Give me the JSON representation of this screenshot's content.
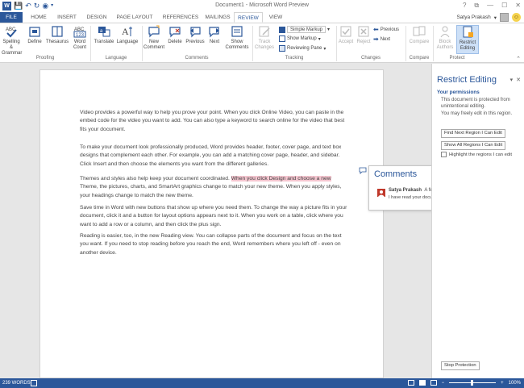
{
  "window": {
    "title": "Document1 - Microsoft Word Preview",
    "controls": [
      "?",
      "⧉",
      "—",
      "☐",
      "✕"
    ]
  },
  "tabs": [
    {
      "label": "FILE"
    },
    {
      "label": "HOME"
    },
    {
      "label": "INSERT"
    },
    {
      "label": "DESIGN"
    },
    {
      "label": "PAGE LAYOUT"
    },
    {
      "label": "REFERENCES"
    },
    {
      "label": "MAILINGS"
    },
    {
      "label": "REVIEW"
    },
    {
      "label": "VIEW"
    }
  ],
  "user": {
    "name": "Satya Prakash"
  },
  "ribbon": {
    "proofing": {
      "label": "Proofing",
      "spelling": "Spelling &\nGrammar",
      "define": "Define",
      "thesaurus": "Thesaurus",
      "word_count": "Word\nCount"
    },
    "language": {
      "label": "Language",
      "translate": "Translate",
      "language": "Language"
    },
    "comments": {
      "label": "Comments",
      "new": "New\nComment",
      "delete": "Delete",
      "previous": "Previous",
      "next": "Next",
      "show": "Show\nComments"
    },
    "tracking": {
      "label": "Tracking",
      "track_changes": "Track\nChanges",
      "markup_mode": "Simple Markup",
      "show_markup": "Show Markup",
      "reviewing_pane": "Reviewing Pane"
    },
    "changes": {
      "label": "Changes",
      "accept": "Accept",
      "reject": "Reject",
      "previous": "Previous",
      "next": "Next"
    },
    "compare": {
      "label": "Compare",
      "compare": "Compare"
    },
    "protect": {
      "label": "Protect",
      "block_authors": "Block\nAuthors",
      "restrict_editing": "Restrict\nEditing"
    }
  },
  "document": {
    "paragraphs": [
      {
        "text": "Video provides a powerful way to help you prove your point. When you click Online Video, you can paste in the embed code for the video you want to add. You can also type a keyword to search online for the video that best fits your document."
      },
      {
        "text": "To make your document look professionally produced, Word provides header, footer, cover page, and text box designs that complement each other. For example, you can add a matching cover page, header, and sidebar. Click Insert and then choose the elements you want from the different galleries."
      },
      {
        "before": "Themes and styles also help keep your document coordinated. ",
        "highlight": "When you click Design and choose a new",
        "after": " Theme, the pictures, charts, and SmartArt graphics change to match your new theme. When you apply styles, your headings change to match the new theme."
      },
      {
        "text": "Save time in Word with new buttons that show up where you need them. To change the way a picture fits in your document, click it and a button for layout options appears next to it. When you work on a table, click where you want to add a row or a column, and then click the plus sign."
      },
      {
        "text": "Reading is easier, too, in the new Reading view. You can collapse parts of the document and focus on the text you want. If you need to stop reading before you reach the end, Word remembers where you left off - even on another device."
      }
    ]
  },
  "comments_pane": {
    "title": "Comments",
    "entries": [
      {
        "author": "Satya Prakash",
        "time": "A few seconds ago",
        "text": "I have read your document. No any mistake found"
      }
    ]
  },
  "restrict_pane": {
    "title": "Restrict Editing",
    "permissions_heading": "Your permissions",
    "protected_text": "This document is protected from unintentional editing.",
    "freely_edit_text": "You may freely edit in this region.",
    "find_next_label": "Find Next Region I Can Edit",
    "show_all_label": "Show All Regions I Can Edit",
    "highlight_label": "Highlight the regions I can edit",
    "stop_label": "Stop Protection"
  },
  "status": {
    "words": "239 WORDS",
    "zoom": "100%"
  },
  "colors": {
    "accent": "#2b579a",
    "highlight": "#f5c6d0",
    "comment_avatar": "#c0392b"
  }
}
